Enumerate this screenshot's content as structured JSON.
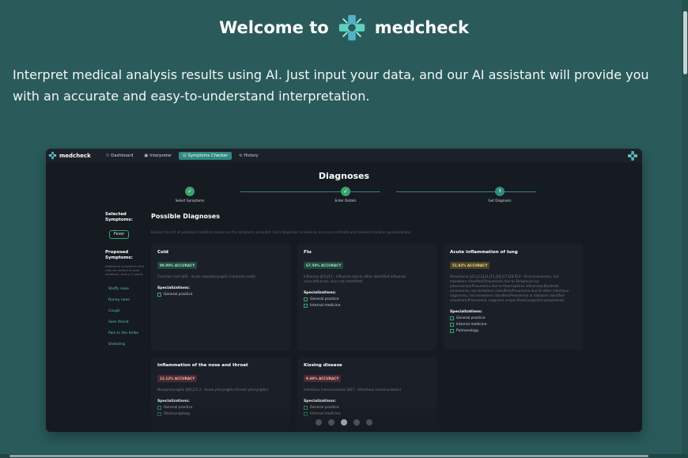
{
  "hero": {
    "title_prefix": "Welcome to",
    "brand": "medcheck",
    "description": "Interpret medical analysis results using AI. Just input your data, and our AI assistant will provide you with an accurate and easy-to-understand interpretation."
  },
  "app": {
    "brand": "medcheck",
    "nav": [
      {
        "label": "Dashboard",
        "icon": "user-icon"
      },
      {
        "label": "Interpreter",
        "icon": "camera-icon"
      },
      {
        "label": "Symptoms Checker",
        "icon": "checklist-icon",
        "active": true
      },
      {
        "label": "History",
        "icon": "history-icon"
      }
    ],
    "page_title": "Diagnoses",
    "steps": [
      {
        "label": "Select Symptoms",
        "state": "done"
      },
      {
        "label": "Enter Details",
        "state": "done"
      },
      {
        "label": "Get Diagnosis",
        "state": "current",
        "number": "3"
      }
    ],
    "sidebar": {
      "selected_title": "Selected Symptoms:",
      "selected": [
        "Fever"
      ],
      "proposed_title": "Proposed Symptoms:",
      "proposed_note": "Additional symptoms that may be related to your condition, every 3 could):",
      "proposed": [
        "Stuffy nose",
        "Runny nose",
        "Cough",
        "Sore throat",
        "Pain in the limbs",
        "Sneezing"
      ]
    },
    "possible_title": "Possible Diagnoses",
    "possible_subtitle": "Explore the list of potential conditions based on the symptoms provided. Each diagnosis includes an accuracy estimate and relevant medical specializations.",
    "specializations_label": "Specializations:",
    "diagnoses": [
      {
        "name": "Cold",
        "accuracy": "90.00% ACCURACY",
        "level": "green",
        "description": "Common cold (J00 - Acute nasopharyngitis [common cold])",
        "specializations": [
          "General practice"
        ]
      },
      {
        "name": "Flu",
        "accuracy": "67.50% ACCURACY",
        "level": "green",
        "description": "Influenza (J10,J11 - Influenza due to other identified influenza virus;Influenza, virus not identified)",
        "specializations": [
          "General practice",
          "Internal medicine"
        ]
      },
      {
        "name": "Acute inflammation of lung",
        "accuracy": "51.92% ACCURACY",
        "level": "olive",
        "description": "Pneumonia (J12,J13,J14,J15,J16,J17,J18,P23 - Viral pneumonia, not elsewhere classified;Pneumonia due to Streptococcus pneumoniae;Pneumonia due to Haemophilus influenzae;Bacterial pneumonia, not elsewhere classified;Pneumonia due to other infectious organisms, not elsewhere classified;Pneumonia in diseases classified elsewhere;Pneumonia, organism unspecified;Congenital pneumonia)",
        "specializations": [
          "General practice",
          "Internal medicine",
          "Pulmonology"
        ]
      },
      {
        "name": "Inflammation of the nose and throat",
        "accuracy": "12.12% ACCURACY",
        "level": "red",
        "description": "Nasopharyngitis (J00,J31.2 - Acute pharyngitis;Chronic pharyngitis)",
        "specializations": [
          "General practice",
          "Otolaryngology"
        ]
      },
      {
        "name": "Kissing disease",
        "accuracy": "9.69% ACCURACY",
        "level": "red",
        "description": "Infectious mononucleosis (B27 - Infectious mononucleosis)",
        "specializations": [
          "General practice",
          "Internal medicine"
        ]
      }
    ],
    "pagination": {
      "pages": 5,
      "active": 3
    }
  },
  "colors": {
    "background": "#2a5b5a",
    "accent": "#2f8a82",
    "success": "#3aa36d",
    "panel": "#161a21"
  }
}
